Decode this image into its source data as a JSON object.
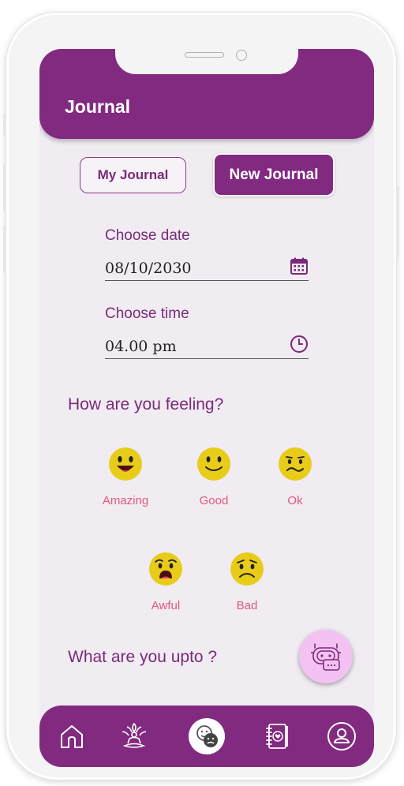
{
  "header": {
    "title": "Journal"
  },
  "tabs": [
    {
      "label": "My Journal",
      "active": false
    },
    {
      "label": "New Journal",
      "active": true
    }
  ],
  "form": {
    "date": {
      "label": "Choose date",
      "value": "08/10/2030",
      "icon": "calendar-icon"
    },
    "time": {
      "label": "Choose time",
      "value": "04.00 pm",
      "icon": "clock-icon"
    }
  },
  "feeling": {
    "title": "How are you feeling?",
    "moods": [
      {
        "label": "Amazing",
        "icon": "amazing-face-icon"
      },
      {
        "label": "Good",
        "icon": "good-face-icon"
      },
      {
        "label": "Ok",
        "icon": "ok-face-icon"
      },
      {
        "label": "Awful",
        "icon": "awful-face-icon"
      },
      {
        "label": "Bad",
        "icon": "bad-face-icon"
      }
    ]
  },
  "activity": {
    "title": "What are you upto ?"
  },
  "fab": {
    "icon": "chatbot-icon"
  },
  "nav": [
    {
      "icon": "home-icon"
    },
    {
      "icon": "meditation-icon"
    },
    {
      "icon": "mood-journal-icon",
      "active": true
    },
    {
      "icon": "notebook-heart-icon"
    },
    {
      "icon": "profile-icon"
    }
  ],
  "colors": {
    "primary": "#822a80",
    "background": "#f0ecf2",
    "mood_label": "#e3587a",
    "emoji": "#e8cc1a",
    "fab": "#f4c2f2"
  }
}
